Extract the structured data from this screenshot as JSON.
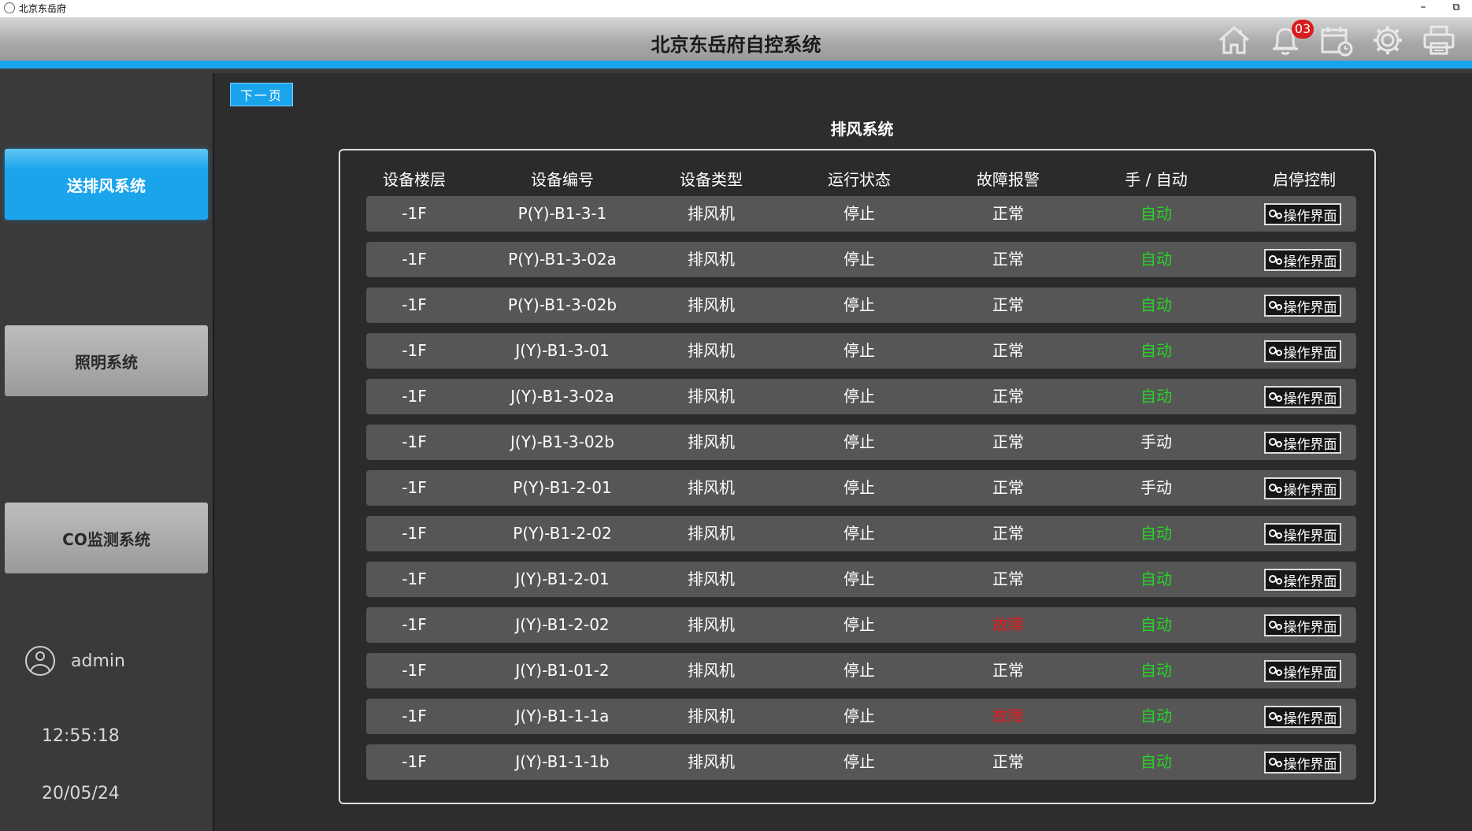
{
  "window": {
    "title": "北京东岳府",
    "minimize_glyph": "–",
    "restore_glyph": "⧉"
  },
  "header": {
    "title": "北京东岳府自控系统",
    "notification_count": "03",
    "icons": [
      "home-icon",
      "bell-icon",
      "calendar-clock-icon",
      "gear-icon",
      "printer-icon"
    ]
  },
  "colors": {
    "accent": "#1aa4ec",
    "auto": "#28d428",
    "fault": "#e01818"
  },
  "sidebar": {
    "items": [
      {
        "label": "送排风系统",
        "active": true
      },
      {
        "label": "照明系统",
        "active": false
      },
      {
        "label": "CO监测系统",
        "active": false
      }
    ],
    "user": "admin",
    "time": "12:55:18",
    "date": "20/05/24"
  },
  "main": {
    "next_page": "下一页",
    "title": "排风系统",
    "columns": [
      "设备楼层",
      "设备编号",
      "设备类型",
      "运行状态",
      "故障报警",
      "手 / 自动",
      "启停控制"
    ],
    "rows": [
      {
        "floor": "-1F",
        "code": "P(Y)-B1-3-1",
        "type": "排风机",
        "run": "停止",
        "alarm": "正常",
        "mode": "自动",
        "control": "操作界面"
      },
      {
        "floor": "-1F",
        "code": "P(Y)-B1-3-02a",
        "type": "排风机",
        "run": "停止",
        "alarm": "正常",
        "mode": "自动",
        "control": "操作界面"
      },
      {
        "floor": "-1F",
        "code": "P(Y)-B1-3-02b",
        "type": "排风机",
        "run": "停止",
        "alarm": "正常",
        "mode": "自动",
        "control": "操作界面"
      },
      {
        "floor": "-1F",
        "code": "J(Y)-B1-3-01",
        "type": "排风机",
        "run": "停止",
        "alarm": "正常",
        "mode": "自动",
        "control": "操作界面"
      },
      {
        "floor": "-1F",
        "code": "J(Y)-B1-3-02a",
        "type": "排风机",
        "run": "停止",
        "alarm": "正常",
        "mode": "自动",
        "control": "操作界面"
      },
      {
        "floor": "-1F",
        "code": "J(Y)-B1-3-02b",
        "type": "排风机",
        "run": "停止",
        "alarm": "正常",
        "mode": "手动",
        "control": "操作界面"
      },
      {
        "floor": "-1F",
        "code": "P(Y)-B1-2-01",
        "type": "排风机",
        "run": "停止",
        "alarm": "正常",
        "mode": "手动",
        "control": "操作界面"
      },
      {
        "floor": "-1F",
        "code": "P(Y)-B1-2-02",
        "type": "排风机",
        "run": "停止",
        "alarm": "正常",
        "mode": "自动",
        "control": "操作界面"
      },
      {
        "floor": "-1F",
        "code": "J(Y)-B1-2-01",
        "type": "排风机",
        "run": "停止",
        "alarm": "正常",
        "mode": "自动",
        "control": "操作界面"
      },
      {
        "floor": "-1F",
        "code": "J(Y)-B1-2-02",
        "type": "排风机",
        "run": "停止",
        "alarm": "故障",
        "mode": "自动",
        "control": "操作界面"
      },
      {
        "floor": "-1F",
        "code": "J(Y)-B1-01-2",
        "type": "排风机",
        "run": "停止",
        "alarm": "正常",
        "mode": "自动",
        "control": "操作界面"
      },
      {
        "floor": "-1F",
        "code": "J(Y)-B1-1-1a",
        "type": "排风机",
        "run": "停止",
        "alarm": "故障",
        "mode": "自动",
        "control": "操作界面"
      },
      {
        "floor": "-1F",
        "code": "J(Y)-B1-1-1b",
        "type": "排风机",
        "run": "停止",
        "alarm": "正常",
        "mode": "自动",
        "control": "操作界面"
      }
    ]
  }
}
